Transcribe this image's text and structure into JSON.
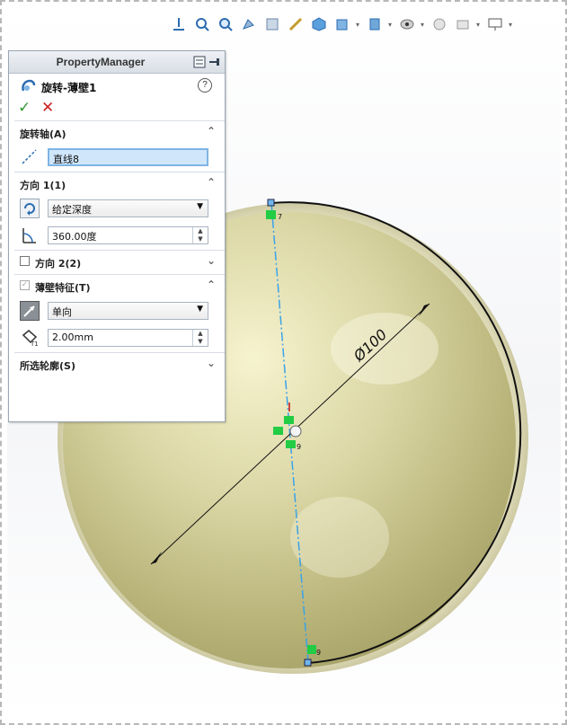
{
  "property_manager": {
    "title": "PropertyManager",
    "feature_name": "旋转-薄壁1",
    "help": "?",
    "ok": "✓",
    "cancel": "✕",
    "axis_section": {
      "title": "旋转轴(A)",
      "value": "直线8"
    },
    "direction1": {
      "title": "方向 1(1)",
      "end_condition": "给定深度",
      "angle": "360.00度"
    },
    "direction2": {
      "title": "方向 2(2)",
      "checked": false
    },
    "thin_feature": {
      "title": "薄壁特征(T)",
      "checked": true,
      "type": "单向",
      "thickness": "2.00mm"
    },
    "selected_contours": {
      "title": "所选轮廓(S)"
    }
  },
  "sketch": {
    "dimension_text": "Ø100",
    "relation_labels": [
      "7",
      "9",
      "9"
    ]
  },
  "icons": [
    "view-orientation-icon",
    "zoom-to-fit-icon",
    "zoom-area-icon",
    "previous-view-icon",
    "section-view-icon",
    "dynamic-annotation-icon",
    "view-cube-icon",
    "display-style-icon",
    "hide-show-icon",
    "edit-appearance-icon",
    "apply-scene-icon",
    "view-settings-icon"
  ],
  "colors": {
    "sphere": "#d8d4a0",
    "axis": "#3aa3e8",
    "relation": "#22cc44",
    "annotation": "#cc1111"
  }
}
